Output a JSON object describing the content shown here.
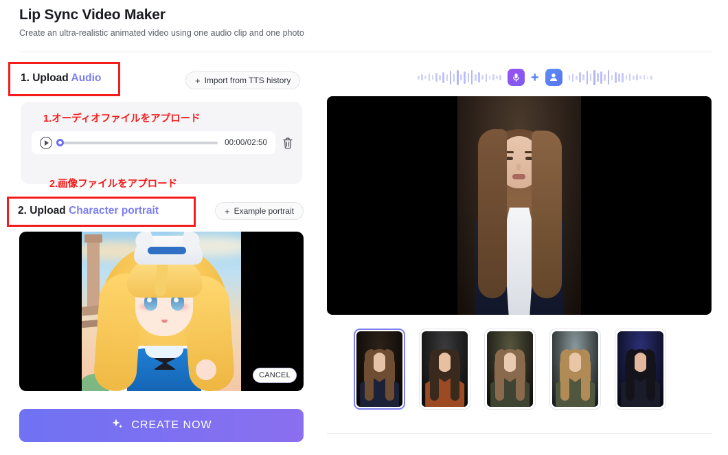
{
  "header": {
    "title": "Lip Sync Video Maker",
    "subtitle": "Create an ultra-realistic animated video using one audio clip and one photo"
  },
  "left": {
    "audio_section": {
      "step_number": "1. Upload ",
      "step_accent": "Audio",
      "import_button": "Import from TTS history",
      "import_button_plus": "+",
      "annotation": "1.オーディオファイルをアプロード",
      "player": {
        "play_icon": "play-icon",
        "current_time": "00:00",
        "separator": "/",
        "duration": "02:50",
        "time_display": "00:00/02:50",
        "progress_percent": 0,
        "delete_icon": "trash-icon"
      }
    },
    "portrait_section": {
      "step_number": "2. Upload ",
      "step_accent": "Character portrait",
      "example_button": "Example portrait",
      "example_button_plus": "+",
      "annotation": "2.画像ファイルをアプロード",
      "cancel_button": "CANCEL"
    },
    "create_button": {
      "label": "CREATE NOW",
      "icon": "sparkle-icon"
    }
  },
  "right": {
    "wave_header": {
      "mic_icon": "microphone-icon",
      "plus": "+",
      "person_icon": "person-icon",
      "left_wave_heights": [
        6,
        9,
        5,
        11,
        7,
        13,
        8,
        16,
        10,
        20,
        12,
        22,
        9,
        18,
        14,
        21,
        10,
        15,
        7,
        12,
        6,
        9,
        5,
        8
      ],
      "right_wave_heights": [
        8,
        12,
        6,
        15,
        9,
        20,
        11,
        22,
        13,
        18,
        10,
        21,
        8,
        16,
        12,
        14,
        7,
        11,
        6,
        9,
        5,
        7,
        4,
        6
      ]
    },
    "preview": {
      "alt": "generated-portrait-preview"
    },
    "thumbnails": [
      {
        "name": "portrait-woman-navy-suit",
        "selected": true,
        "bg": "#2e2219",
        "skin": "#e6c3a8",
        "hair": "#6f4d33",
        "cloth": "#1b2137"
      },
      {
        "name": "portrait-man-rust-jacket",
        "selected": false,
        "bg": "#3b3b3d",
        "skin": "#e7c0a1",
        "hair": "#3a2a1d",
        "cloth": "#9c4a23"
      },
      {
        "name": "portrait-woman-olive-top",
        "selected": false,
        "bg": "#57573f",
        "skin": "#e9cbb2",
        "hair": "#8a6a4c",
        "cloth": "#3f4331"
      },
      {
        "name": "portrait-man-olive-shirt",
        "selected": false,
        "bg": "#8a9a9c",
        "skin": "#e9c6a6",
        "hair": "#b08b55",
        "cloth": "#51573f"
      },
      {
        "name": "portrait-cyberpunk-woman",
        "selected": false,
        "bg": "#2b2f74",
        "skin": "#e3b79c",
        "hair": "#14131c",
        "cloth": "#1b1c2a"
      }
    ]
  },
  "colors": {
    "accent": "#7b7ef0",
    "annotation_red": "#f41b1b",
    "button_gradient_start": "#6f72f3",
    "button_gradient_end": "#8a6ff0",
    "text_primary": "#1b1c21",
    "text_secondary": "#5d6168"
  }
}
